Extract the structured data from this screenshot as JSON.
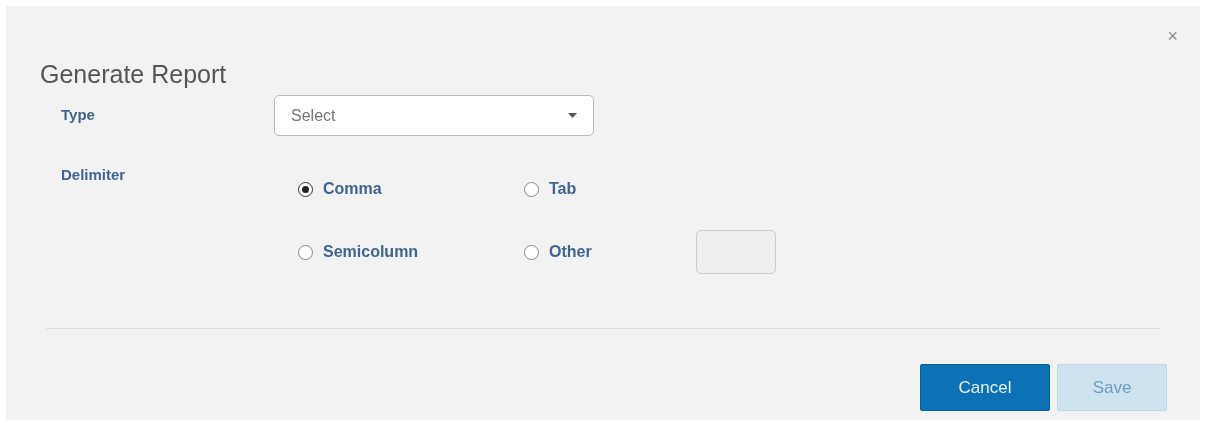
{
  "dialog": {
    "title": "Generate Report",
    "close": "×"
  },
  "type_field": {
    "label": "Type",
    "placeholder": "Select"
  },
  "delimiter": {
    "label": "Delimiter",
    "options": [
      {
        "label": "Comma",
        "selected": true
      },
      {
        "label": "Tab",
        "selected": false
      },
      {
        "label": "Semicolumn",
        "selected": false
      },
      {
        "label": "Other",
        "selected": false
      }
    ]
  },
  "buttons": [
    {
      "label": "Cancel",
      "disabled": false
    },
    {
      "label": "Save",
      "disabled": true
    }
  ]
}
